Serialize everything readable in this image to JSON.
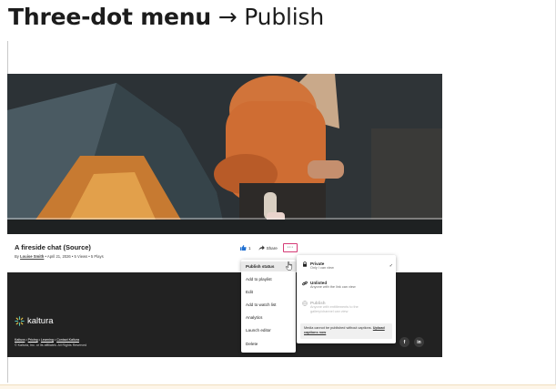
{
  "heading": {
    "bold": "Three-dot menu",
    "arrow": "→",
    "rest": "Publish"
  },
  "video": {
    "title": "A fireside chat (Source)",
    "meta_by": "By",
    "author": "Louise Smith",
    "meta_rest": " • April 21, 2026 • 5 Views • 5 Plays"
  },
  "actions": {
    "like_count": "1",
    "share_label": "Share",
    "more_label": "···"
  },
  "menu": {
    "items": [
      "Publish status",
      "Add to playlist",
      "Edit",
      "Add to watch list",
      "Analytics",
      "Launch editor",
      "Delete"
    ]
  },
  "publish_status": {
    "options": [
      {
        "title": "Private",
        "desc_line1": "Only I can view",
        "desc_line2": "",
        "icon": "lock-icon",
        "selected": true,
        "disabled": false
      },
      {
        "title": "Unlisted",
        "desc_line1": "Anyone with the link can view",
        "desc_line2": "",
        "icon": "link-icon",
        "selected": false,
        "disabled": false
      },
      {
        "title": "Publish",
        "desc_line1": "Anyone with entitlements to the",
        "desc_line2": "gallery/channel can view",
        "icon": "globe-icon",
        "selected": false,
        "disabled": true
      }
    ],
    "check": "✓",
    "notice_text": "Media cannot be published without captions.",
    "notice_link": "Upload captions now"
  },
  "footer": {
    "brand": "kaltura",
    "links": [
      "Kaltura",
      "Pricing",
      "Learning",
      "Contact Kaltura"
    ],
    "separator": "•",
    "copyright": "© Kaltura, Inc. or its affiliates. All Rights Reserved",
    "social": [
      "f",
      "in"
    ]
  },
  "colors": {
    "accent_outline": "#d53a76",
    "like_blue": "#1f6fd1",
    "footer_bg": "#222222",
    "brand_mark": "#58c7b7"
  }
}
